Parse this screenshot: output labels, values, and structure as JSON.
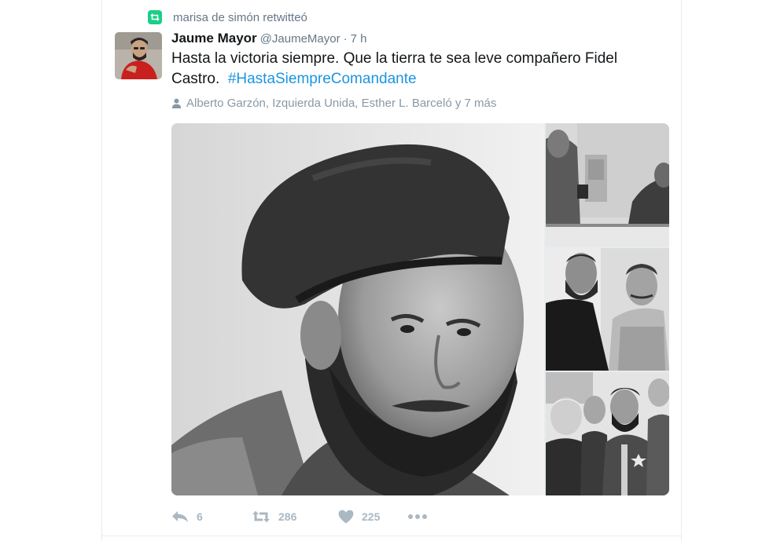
{
  "retweet_context": {
    "text": "marisa de simón retwitteó",
    "icon": "retweet-icon",
    "color": "#19cf86"
  },
  "tweet": {
    "author_name": "Jaume Mayor",
    "author_handle": "@JaumeMayor",
    "separator": "·",
    "time": "7 h",
    "text": "Hasta la victoria siempre. Que la tierra te sea leve compañero Fidel Castro.",
    "hashtag": "#HastaSiempreComandante",
    "mentions_text": "Alberto Garzón, Izquierda Unida, Esther L. Barceló y 7 más",
    "mentions_icon": "person-icon"
  },
  "media": {
    "photos": [
      {
        "icon": "photo-portrait-beret"
      },
      {
        "icon": "photo-men-in-room"
      },
      {
        "icon": "photo-two-men-smiling"
      },
      {
        "icon": "photo-group-with-woman"
      }
    ]
  },
  "actions": {
    "reply_count": "6",
    "retweet_count": "286",
    "like_count": "225",
    "reply_icon": "reply-icon",
    "retweet_icon": "retweet-icon",
    "like_icon": "heart-icon",
    "more_icon": "more-icon"
  },
  "colors": {
    "link": "#1b95e0",
    "secondary_text": "#657786",
    "action_gray": "#aab8c2",
    "retweet_green": "#19cf86"
  }
}
